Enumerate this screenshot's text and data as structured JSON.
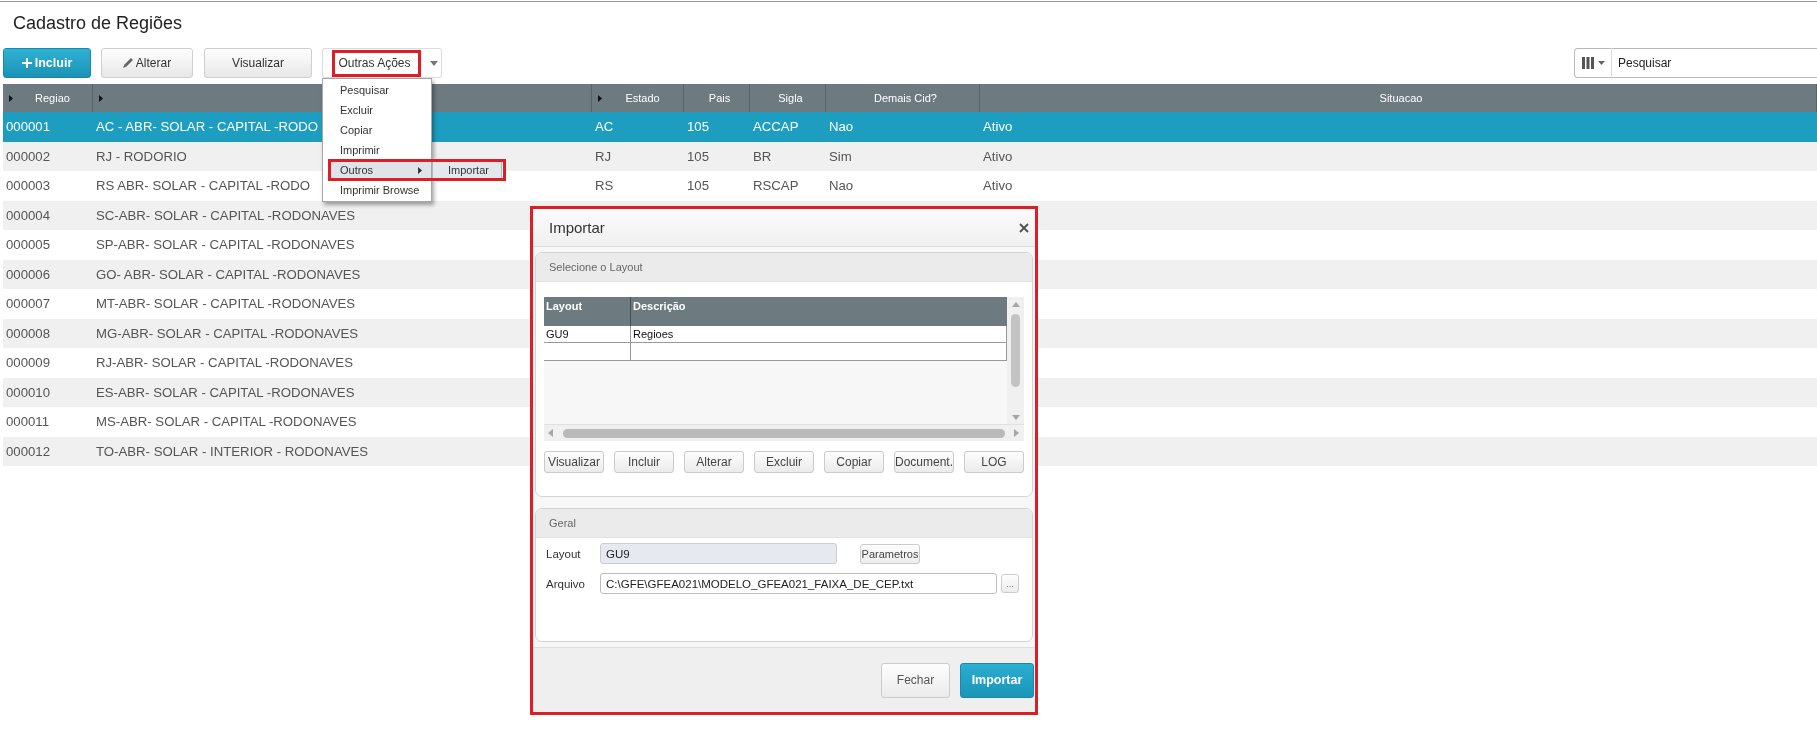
{
  "page": {
    "title": "Cadastro de Regiões"
  },
  "toolbar": {
    "buttons": [
      {
        "label": "Incluir",
        "kind": "add"
      },
      {
        "label": "Alterar",
        "kind": "edit"
      },
      {
        "label": "Visualizar",
        "kind": "view"
      }
    ],
    "more_actions": {
      "label": "Outras Ações",
      "highlighted": true,
      "expanded": true,
      "items": [
        {
          "label": "Pesquisar",
          "selected": false,
          "highlighted": false
        },
        {
          "label": "Excluir",
          "selected": false,
          "highlighted": false
        },
        {
          "label": "Copiar",
          "selected": false,
          "highlighted": false
        },
        {
          "label": "Imprimir",
          "selected": false,
          "highlighted": false
        },
        {
          "label": "Outros",
          "selected": true,
          "highlighted": true,
          "submenu": [
            {
              "label": "Importar",
              "selected": true
            }
          ]
        },
        {
          "label": "Imprimir Browse",
          "selected": false,
          "highlighted": false
        }
      ]
    }
  },
  "search": {
    "placeholder": "Pesquisar"
  },
  "table": {
    "columns": [
      {
        "label": "Regiao",
        "expander": true
      },
      {
        "expander": true
      },
      {
        "label": "Estado",
        "expander": true
      },
      {
        "label": "Pais",
        "expander": false
      },
      {
        "label": "Sigla",
        "expander": false
      },
      {
        "label": "Demais Cid?",
        "expander": false
      },
      {
        "label": "Situacao",
        "expander": false
      }
    ],
    "rows": [
      {
        "cells": [
          "000001",
          "AC - ABR- SOLAR - CAPITAL -RODO",
          "AC",
          "105",
          "ACCAP",
          "Nao",
          "Ativo"
        ],
        "selected": true
      },
      {
        "cells": [
          "000002",
          "RJ - RODORIO",
          "RJ",
          "105",
          "BR",
          "Sim",
          "Ativo"
        ],
        "selected": false
      },
      {
        "cells": [
          "000003",
          "RS ABR- SOLAR - CAPITAL -RODO",
          "RS",
          "105",
          "RSCAP",
          "Nao",
          "Ativo"
        ],
        "selected": false
      },
      {
        "cells": [
          "000004",
          "SC-ABR- SOLAR - CAPITAL -RODONAVES"
        ],
        "selected": false
      },
      {
        "cells": [
          "000005",
          "SP-ABR- SOLAR - CAPITAL -RODONAVES"
        ],
        "selected": false
      },
      {
        "cells": [
          "000006",
          "GO- ABR- SOLAR - CAPITAL -RODONAVES"
        ],
        "selected": false
      },
      {
        "cells": [
          "000007",
          "MT-ABR- SOLAR - CAPITAL -RODONAVES"
        ],
        "selected": false
      },
      {
        "cells": [
          "000008",
          "MG-ABR- SOLAR - CAPITAL -RODONAVES"
        ],
        "selected": false
      },
      {
        "cells": [
          "000009",
          "RJ-ABR- SOLAR - CAPITAL -RODONAVES"
        ],
        "selected": false
      },
      {
        "cells": [
          "000010",
          "ES-ABR- SOLAR - CAPITAL -RODONAVES"
        ],
        "selected": false
      },
      {
        "cells": [
          "000011",
          "MS-ABR- SOLAR - CAPITAL -RODONAVES"
        ],
        "selected": false
      },
      {
        "cells": [
          "000012",
          "TO-ABR- SOLAR - INTERIOR - RODONAVES"
        ],
        "selected": false
      }
    ]
  },
  "dialog": {
    "title": "Importar",
    "highlighted": true,
    "layout_panel": {
      "title": "Selecione o Layout",
      "columns": [
        "Layout",
        "Descrição"
      ],
      "rows": [
        {
          "cells": [
            "GU9",
            "Regioes"
          ]
        }
      ],
      "buttons": [
        "Visualizar",
        "Incluir",
        "Alterar",
        "Excluir",
        "Copiar",
        "Document.",
        "LOG"
      ]
    },
    "general_panel": {
      "title": "Geral",
      "fields": [
        {
          "label": "Layout",
          "value": "GU9",
          "disabled": true,
          "button": {
            "label": "Parametros",
            "kind": "action"
          }
        },
        {
          "label": "Arquivo",
          "value": "C:\\GFE\\GFEA021\\MODELO_GFEA021_FAIXA_DE_CEP.txt",
          "disabled": false,
          "button": {
            "label": "...",
            "kind": "browse"
          }
        }
      ]
    },
    "footer_buttons": [
      {
        "label": "Fechar",
        "kind": "secondary"
      },
      {
        "label": "Importar",
        "kind": "primary"
      }
    ]
  }
}
